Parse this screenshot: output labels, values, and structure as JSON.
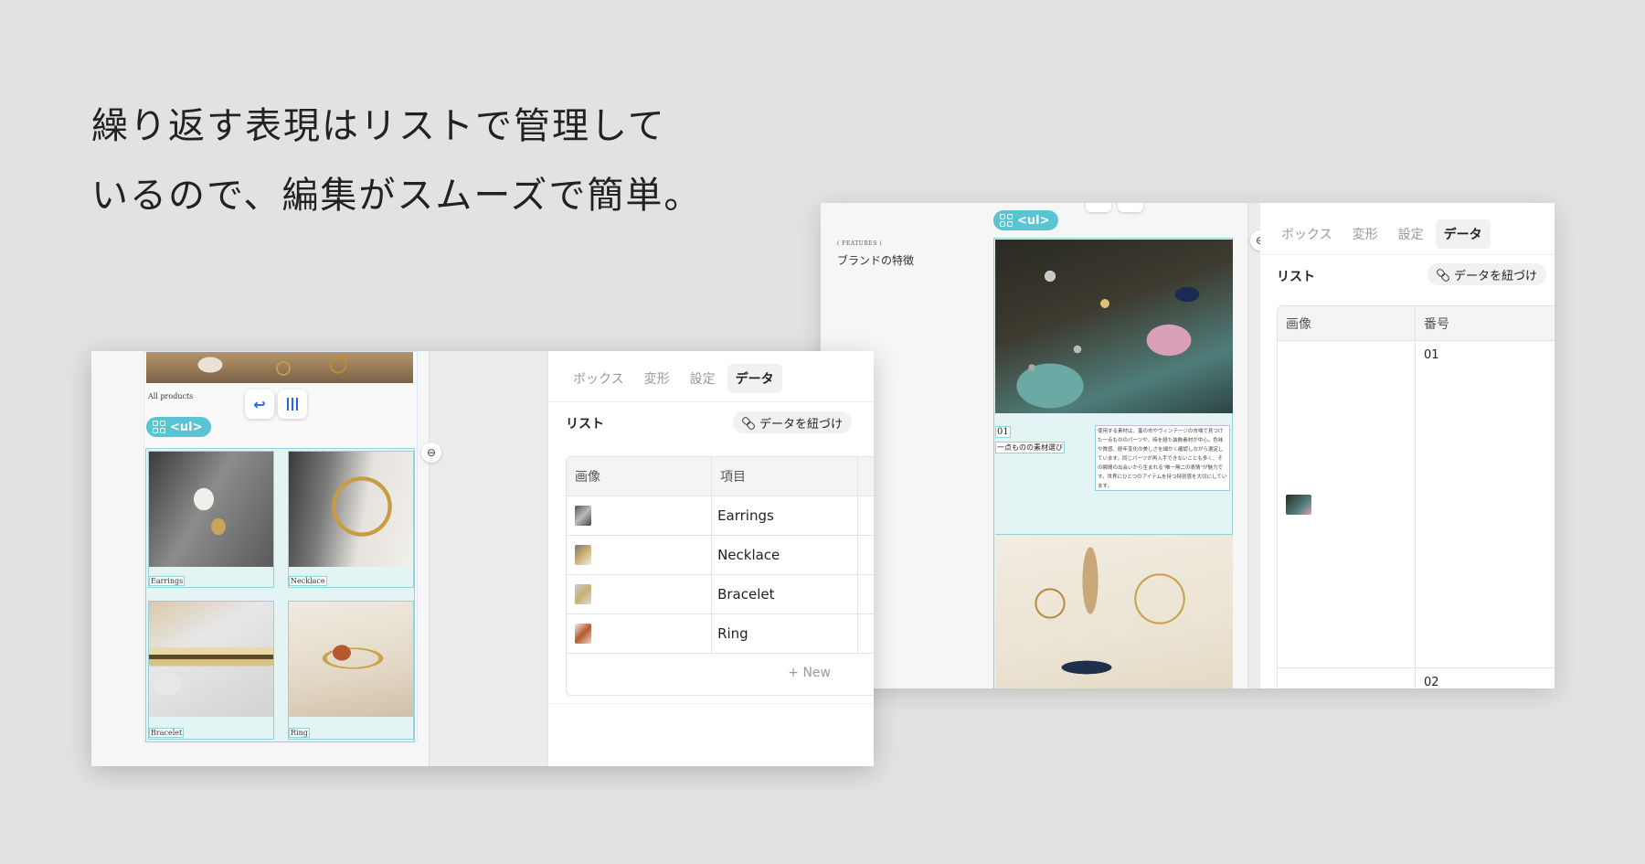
{
  "headline": {
    "line1": "繰り返す表現はリストで管理して",
    "line2": "いるので、編集がスムーズで簡単。"
  },
  "colors": {
    "accent_teal": "#5ac4d2",
    "list_fill": "#e4f3f4",
    "selection_border": "#8fd3dd",
    "action_blue": "#2563eb"
  },
  "ul_badge_label": "<ul>",
  "back_window": {
    "features_small": "( FEATURES )",
    "features_title": "ブランドの特徴",
    "item": {
      "number": "01",
      "title": "一点ものの素材選び",
      "description": "使用する素材は、蚤の市やヴィンテージの市場で見つけた一点もののパーツや、時を経た装飾素材が中心。色味や質感、経年変化の美しさを細かく確認しながら選定しています。同じパーツが再入手できないことも多く、その瞬間の出会いから生まれる\"唯一無二の表情\"が魅力です。世界にひとつのアイテムを持つ特別感を大切にしています。"
    },
    "panel": {
      "tabs": [
        "ボックス",
        "変形",
        "設定",
        "データ"
      ],
      "active_tab": "データ",
      "list_label": "リスト",
      "bind_button": "データを紐づけ",
      "columns": [
        "画像",
        "番号"
      ],
      "rows": [
        {
          "image": "jewelry-photo-thumbnail",
          "number": "01"
        },
        {
          "image": "",
          "number": "02"
        }
      ]
    }
  },
  "front_window": {
    "all_products": "All products",
    "toolbar": {
      "return_icon": "return-arrow-icon",
      "columns_icon": "columns-icon"
    },
    "cards": [
      {
        "caption": "Earrings"
      },
      {
        "caption": "Necklace"
      },
      {
        "caption": "Bracelet"
      },
      {
        "caption": "Ring"
      }
    ],
    "panel": {
      "tabs": [
        "ボックス",
        "変形",
        "設定",
        "データ"
      ],
      "active_tab": "データ",
      "list_label": "リスト",
      "bind_button": "データを紐づけ",
      "columns": [
        "画像",
        "項目"
      ],
      "rows": [
        {
          "image": "earrings-thumbnail",
          "item": "Earrings"
        },
        {
          "image": "necklace-thumbnail",
          "item": "Necklace"
        },
        {
          "image": "bracelet-thumbnail",
          "item": "Bracelet"
        },
        {
          "image": "ring-thumbnail",
          "item": "Ring"
        }
      ],
      "new_button": "+ New"
    }
  }
}
